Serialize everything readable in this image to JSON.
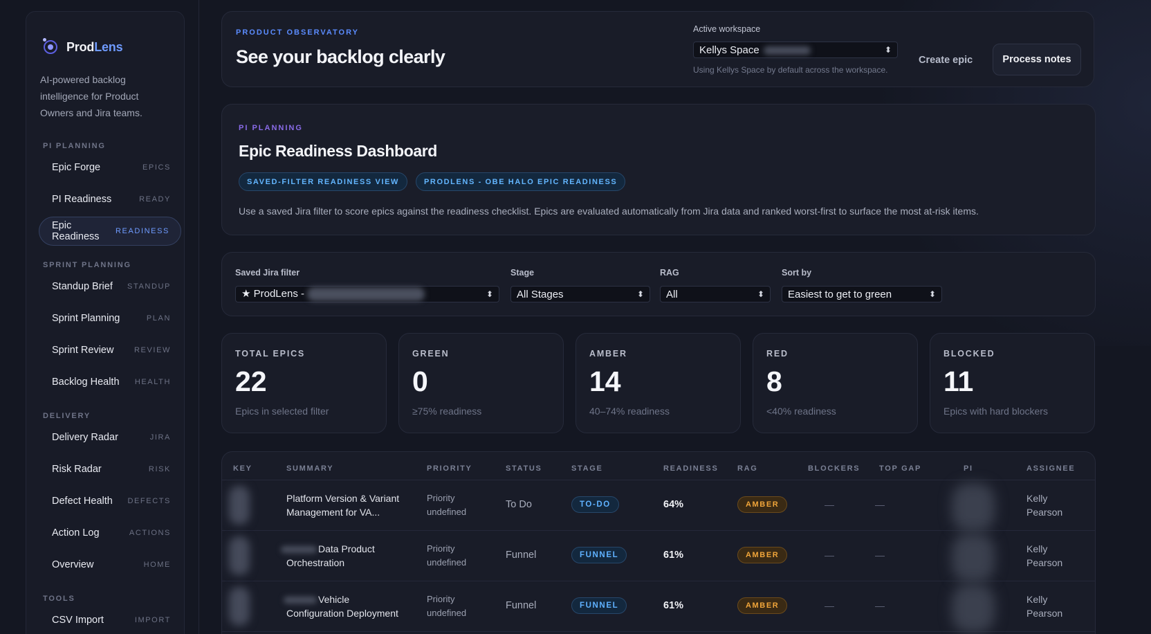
{
  "brand": {
    "name_prefix": "Prod",
    "name_accent": "Lens",
    "description": "AI-powered backlog intelligence for Product Owners and Jira teams."
  },
  "sidebar": {
    "sections": [
      {
        "title": "PI PLANNING",
        "items": [
          {
            "label": "Epic Forge",
            "tag": "EPICS",
            "active": false
          },
          {
            "label": "PI Readiness",
            "tag": "READY",
            "active": false
          },
          {
            "label": "Epic Readiness",
            "tag": "READINESS",
            "active": true
          }
        ]
      },
      {
        "title": "SPRINT PLANNING",
        "items": [
          {
            "label": "Standup Brief",
            "tag": "STANDUP",
            "active": false
          },
          {
            "label": "Sprint Planning",
            "tag": "PLAN",
            "active": false
          },
          {
            "label": "Sprint Review",
            "tag": "REVIEW",
            "active": false
          },
          {
            "label": "Backlog Health",
            "tag": "HEALTH",
            "active": false
          }
        ]
      },
      {
        "title": "DELIVERY",
        "items": [
          {
            "label": "Delivery Radar",
            "tag": "JIRA",
            "active": false
          },
          {
            "label": "Risk Radar",
            "tag": "RISK",
            "active": false
          },
          {
            "label": "Defect Health",
            "tag": "DEFECTS",
            "active": false
          },
          {
            "label": "Action Log",
            "tag": "ACTIONS",
            "active": false
          },
          {
            "label": "Overview",
            "tag": "HOME",
            "active": false
          }
        ]
      },
      {
        "title": "TOOLS",
        "items": [
          {
            "label": "CSV Import",
            "tag": "IMPORT",
            "active": false
          }
        ]
      }
    ]
  },
  "topbar": {
    "eyebrow": "PRODUCT OBSERVATORY",
    "title": "See your backlog clearly",
    "workspace_label": "Active workspace",
    "workspace_value": "Kellys Space",
    "workspace_hint": "Using Kellys Space by default across the workspace.",
    "create_epic_label": "Create epic",
    "process_notes_label": "Process notes"
  },
  "hero": {
    "eyebrow": "PI PLANNING",
    "title": "Epic Readiness Dashboard",
    "pills": [
      "SAVED-FILTER READINESS VIEW",
      "PRODLENS - OBE HALO EPIC READINESS"
    ],
    "description": "Use a saved Jira filter to score epics against the readiness checklist. Epics are evaluated automatically from Jira data and ranked worst-first to surface the most at-risk items."
  },
  "filters": {
    "saved_filter": {
      "label": "Saved Jira filter",
      "value": "★ ProdLens -"
    },
    "stage": {
      "label": "Stage",
      "value": "All Stages"
    },
    "rag": {
      "label": "RAG",
      "value": "All"
    },
    "sort": {
      "label": "Sort by",
      "value": "Easiest to get to green"
    }
  },
  "stats": [
    {
      "label": "TOTAL EPICS",
      "value": "22",
      "sub": "Epics in selected filter"
    },
    {
      "label": "GREEN",
      "value": "0",
      "sub": "≥75% readiness"
    },
    {
      "label": "AMBER",
      "value": "14",
      "sub": "40–74% readiness"
    },
    {
      "label": "RED",
      "value": "8",
      "sub": "<40% readiness"
    },
    {
      "label": "BLOCKED",
      "value": "11",
      "sub": "Epics with hard blockers"
    }
  ],
  "table": {
    "columns": [
      "KEY",
      "SUMMARY",
      "PRIORITY",
      "STATUS",
      "STAGE",
      "READINESS",
      "RAG",
      "BLOCKERS",
      "TOP GAP",
      "PI",
      "ASSIGNEE"
    ],
    "rows": [
      {
        "summary_line1": "Platform Version & Variant",
        "summary_line2": "Management for VA...",
        "priority_line1": "Priority",
        "priority_line2": "undefined",
        "status": "To Do",
        "stage": "TO-DO",
        "readiness": "64%",
        "rag": "AMBER",
        "blockers": "—",
        "top_gap": "—",
        "assignee_line1": "Kelly",
        "assignee_line2": "Pearson"
      },
      {
        "summary_line1": "Data Product",
        "summary_line2": "Orchestration",
        "priority_line1": "Priority",
        "priority_line2": "undefined",
        "status": "Funnel",
        "stage": "FUNNEL",
        "readiness": "61%",
        "rag": "AMBER",
        "blockers": "—",
        "top_gap": "—",
        "assignee_line1": "Kelly",
        "assignee_line2": "Pearson"
      },
      {
        "summary_line1": "Vehicle",
        "summary_line2": "Configuration Deployment",
        "priority_line1": "Priority",
        "priority_line2": "undefined",
        "status": "Funnel",
        "stage": "FUNNEL",
        "readiness": "61%",
        "rag": "AMBER",
        "blockers": "—",
        "top_gap": "—",
        "assignee_line1": "Kelly",
        "assignee_line2": "Pearson"
      }
    ]
  },
  "colors": {
    "background": "#141722",
    "accent_blue": "#5b8cff",
    "accent_purple": "#8a6be8",
    "stage_blue": "#5fb1ff",
    "amber": "#f0a53a"
  },
  "icons": {
    "brand": "prodlens-logo-icon",
    "select_chevron": "chevron-updown-icon"
  }
}
